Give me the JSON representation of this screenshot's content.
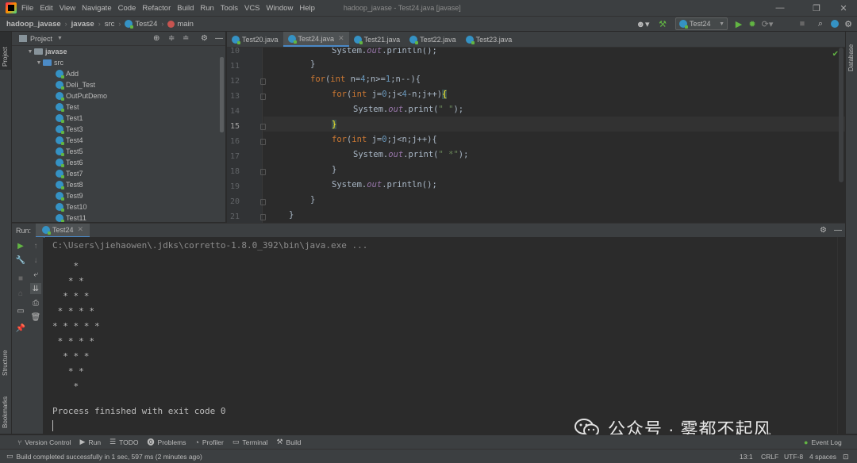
{
  "menu": [
    "File",
    "Edit",
    "View",
    "Navigate",
    "Code",
    "Refactor",
    "Build",
    "Run",
    "Tools",
    "VCS",
    "Window",
    "Help"
  ],
  "window_title": "hadoop_javase - Test24.java [javase]",
  "breadcrumb": [
    "hadoop_javase",
    "javase",
    "src",
    "Test24",
    "main"
  ],
  "run_config": "Test24",
  "project": {
    "header": "Project",
    "root_module": "javase",
    "src_folder": "src",
    "files": [
      "Add",
      "Deli_Test",
      "OutPutDemo",
      "Test",
      "Test1",
      "Test3",
      "Test4",
      "Test5",
      "Test6",
      "Test7",
      "Test8",
      "Test9",
      "Test10",
      "Test11"
    ]
  },
  "left_stripe": {
    "project": "Project",
    "structure": "Structure",
    "bookmarks": "Bookmarks"
  },
  "right_stripe": {
    "database": "Database"
  },
  "tabs": [
    {
      "label": "Test20.java",
      "active": false
    },
    {
      "label": "Test24.java",
      "active": true
    },
    {
      "label": "Test21.java",
      "active": false
    },
    {
      "label": "Test22.java",
      "active": false
    },
    {
      "label": "Test23.java",
      "active": false
    }
  ],
  "editor": {
    "line_numbers": [
      "10",
      "11",
      "12",
      "13",
      "14",
      "15",
      "16",
      "17",
      "18",
      "19",
      "20",
      "21"
    ],
    "current_line": "15"
  },
  "run": {
    "label": "Run:",
    "tab": "Test24",
    "command": "C:\\Users\\jiehaowen\\.jdks\\corretto-1.8.0_392\\bin\\java.exe ...",
    "output": [
      "    *",
      "   * *",
      "  * * *",
      " * * * *",
      "* * * * *",
      " * * * *",
      "  * * *",
      "   * *",
      "    *"
    ],
    "exit_message": "Process finished with exit code 0"
  },
  "tool_windows": [
    "Version Control",
    "Run",
    "TODO",
    "Problems",
    "Profiler",
    "Terminal",
    "Build"
  ],
  "event_log": "Event Log",
  "status": {
    "message": "Build completed successfully in 1 sec, 597 ms (2 minutes ago)",
    "position": "13:1",
    "line_sep": "CRLF",
    "encoding": "UTF-8",
    "indent": "4 spaces"
  },
  "watermark": "公众号 · 雾都不起风",
  "colors": {
    "keyword": "#cc7832",
    "number": "#6897bb",
    "string": "#6a8759",
    "field": "#9876aa",
    "accent": "#4a88c7"
  }
}
